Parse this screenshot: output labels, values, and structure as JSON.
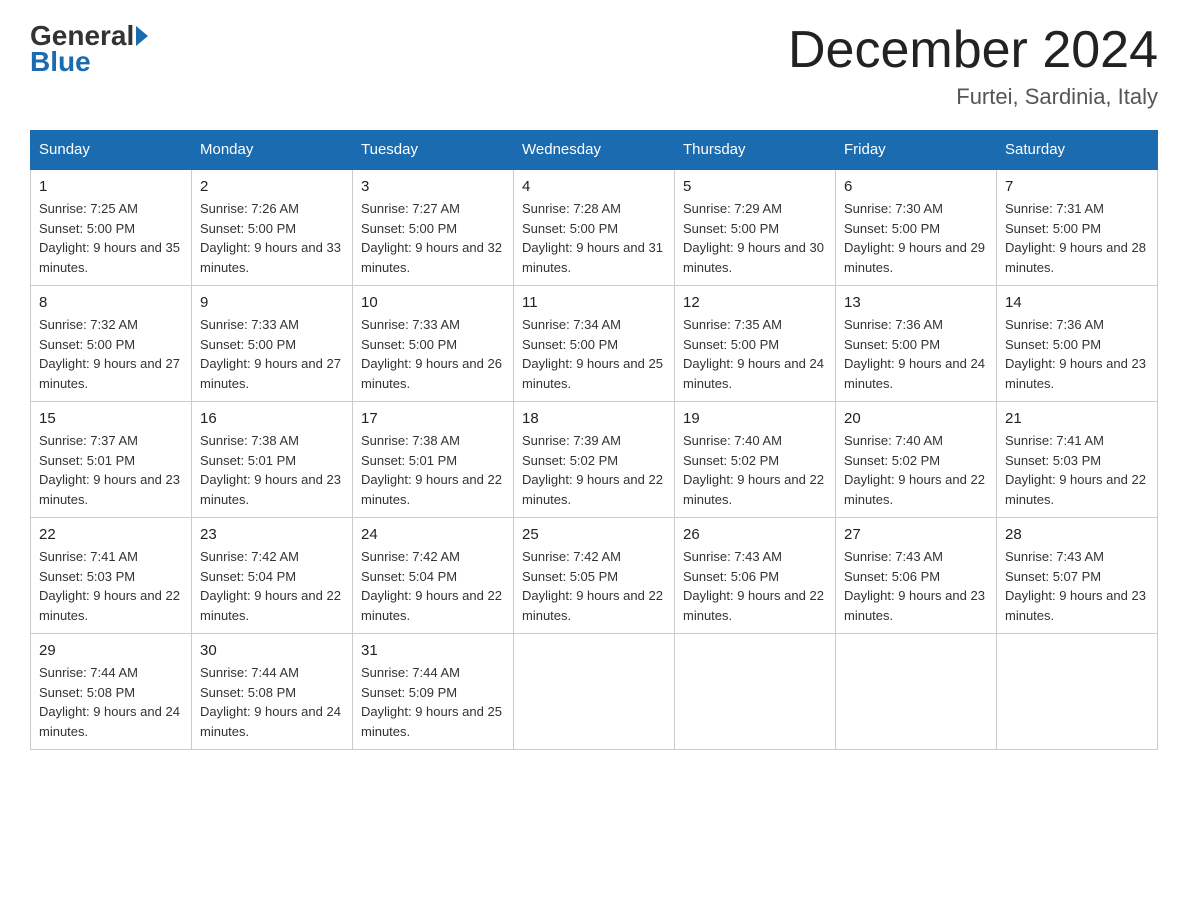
{
  "logo": {
    "general": "General",
    "blue": "Blue"
  },
  "title": "December 2024",
  "subtitle": "Furtei, Sardinia, Italy",
  "days_of_week": [
    "Sunday",
    "Monday",
    "Tuesday",
    "Wednesday",
    "Thursday",
    "Friday",
    "Saturday"
  ],
  "weeks": [
    [
      {
        "day": "1",
        "sunrise": "7:25 AM",
        "sunset": "5:00 PM",
        "daylight": "9 hours and 35 minutes."
      },
      {
        "day": "2",
        "sunrise": "7:26 AM",
        "sunset": "5:00 PM",
        "daylight": "9 hours and 33 minutes."
      },
      {
        "day": "3",
        "sunrise": "7:27 AM",
        "sunset": "5:00 PM",
        "daylight": "9 hours and 32 minutes."
      },
      {
        "day": "4",
        "sunrise": "7:28 AM",
        "sunset": "5:00 PM",
        "daylight": "9 hours and 31 minutes."
      },
      {
        "day": "5",
        "sunrise": "7:29 AM",
        "sunset": "5:00 PM",
        "daylight": "9 hours and 30 minutes."
      },
      {
        "day": "6",
        "sunrise": "7:30 AM",
        "sunset": "5:00 PM",
        "daylight": "9 hours and 29 minutes."
      },
      {
        "day": "7",
        "sunrise": "7:31 AM",
        "sunset": "5:00 PM",
        "daylight": "9 hours and 28 minutes."
      }
    ],
    [
      {
        "day": "8",
        "sunrise": "7:32 AM",
        "sunset": "5:00 PM",
        "daylight": "9 hours and 27 minutes."
      },
      {
        "day": "9",
        "sunrise": "7:33 AM",
        "sunset": "5:00 PM",
        "daylight": "9 hours and 27 minutes."
      },
      {
        "day": "10",
        "sunrise": "7:33 AM",
        "sunset": "5:00 PM",
        "daylight": "9 hours and 26 minutes."
      },
      {
        "day": "11",
        "sunrise": "7:34 AM",
        "sunset": "5:00 PM",
        "daylight": "9 hours and 25 minutes."
      },
      {
        "day": "12",
        "sunrise": "7:35 AM",
        "sunset": "5:00 PM",
        "daylight": "9 hours and 24 minutes."
      },
      {
        "day": "13",
        "sunrise": "7:36 AM",
        "sunset": "5:00 PM",
        "daylight": "9 hours and 24 minutes."
      },
      {
        "day": "14",
        "sunrise": "7:36 AM",
        "sunset": "5:00 PM",
        "daylight": "9 hours and 23 minutes."
      }
    ],
    [
      {
        "day": "15",
        "sunrise": "7:37 AM",
        "sunset": "5:01 PM",
        "daylight": "9 hours and 23 minutes."
      },
      {
        "day": "16",
        "sunrise": "7:38 AM",
        "sunset": "5:01 PM",
        "daylight": "9 hours and 23 minutes."
      },
      {
        "day": "17",
        "sunrise": "7:38 AM",
        "sunset": "5:01 PM",
        "daylight": "9 hours and 22 minutes."
      },
      {
        "day": "18",
        "sunrise": "7:39 AM",
        "sunset": "5:02 PM",
        "daylight": "9 hours and 22 minutes."
      },
      {
        "day": "19",
        "sunrise": "7:40 AM",
        "sunset": "5:02 PM",
        "daylight": "9 hours and 22 minutes."
      },
      {
        "day": "20",
        "sunrise": "7:40 AM",
        "sunset": "5:02 PM",
        "daylight": "9 hours and 22 minutes."
      },
      {
        "day": "21",
        "sunrise": "7:41 AM",
        "sunset": "5:03 PM",
        "daylight": "9 hours and 22 minutes."
      }
    ],
    [
      {
        "day": "22",
        "sunrise": "7:41 AM",
        "sunset": "5:03 PM",
        "daylight": "9 hours and 22 minutes."
      },
      {
        "day": "23",
        "sunrise": "7:42 AM",
        "sunset": "5:04 PM",
        "daylight": "9 hours and 22 minutes."
      },
      {
        "day": "24",
        "sunrise": "7:42 AM",
        "sunset": "5:04 PM",
        "daylight": "9 hours and 22 minutes."
      },
      {
        "day": "25",
        "sunrise": "7:42 AM",
        "sunset": "5:05 PM",
        "daylight": "9 hours and 22 minutes."
      },
      {
        "day": "26",
        "sunrise": "7:43 AM",
        "sunset": "5:06 PM",
        "daylight": "9 hours and 22 minutes."
      },
      {
        "day": "27",
        "sunrise": "7:43 AM",
        "sunset": "5:06 PM",
        "daylight": "9 hours and 23 minutes."
      },
      {
        "day": "28",
        "sunrise": "7:43 AM",
        "sunset": "5:07 PM",
        "daylight": "9 hours and 23 minutes."
      }
    ],
    [
      {
        "day": "29",
        "sunrise": "7:44 AM",
        "sunset": "5:08 PM",
        "daylight": "9 hours and 24 minutes."
      },
      {
        "day": "30",
        "sunrise": "7:44 AM",
        "sunset": "5:08 PM",
        "daylight": "9 hours and 24 minutes."
      },
      {
        "day": "31",
        "sunrise": "7:44 AM",
        "sunset": "5:09 PM",
        "daylight": "9 hours and 25 minutes."
      },
      null,
      null,
      null,
      null
    ]
  ],
  "labels": {
    "sunrise": "Sunrise:",
    "sunset": "Sunset:",
    "daylight": "Daylight:"
  }
}
